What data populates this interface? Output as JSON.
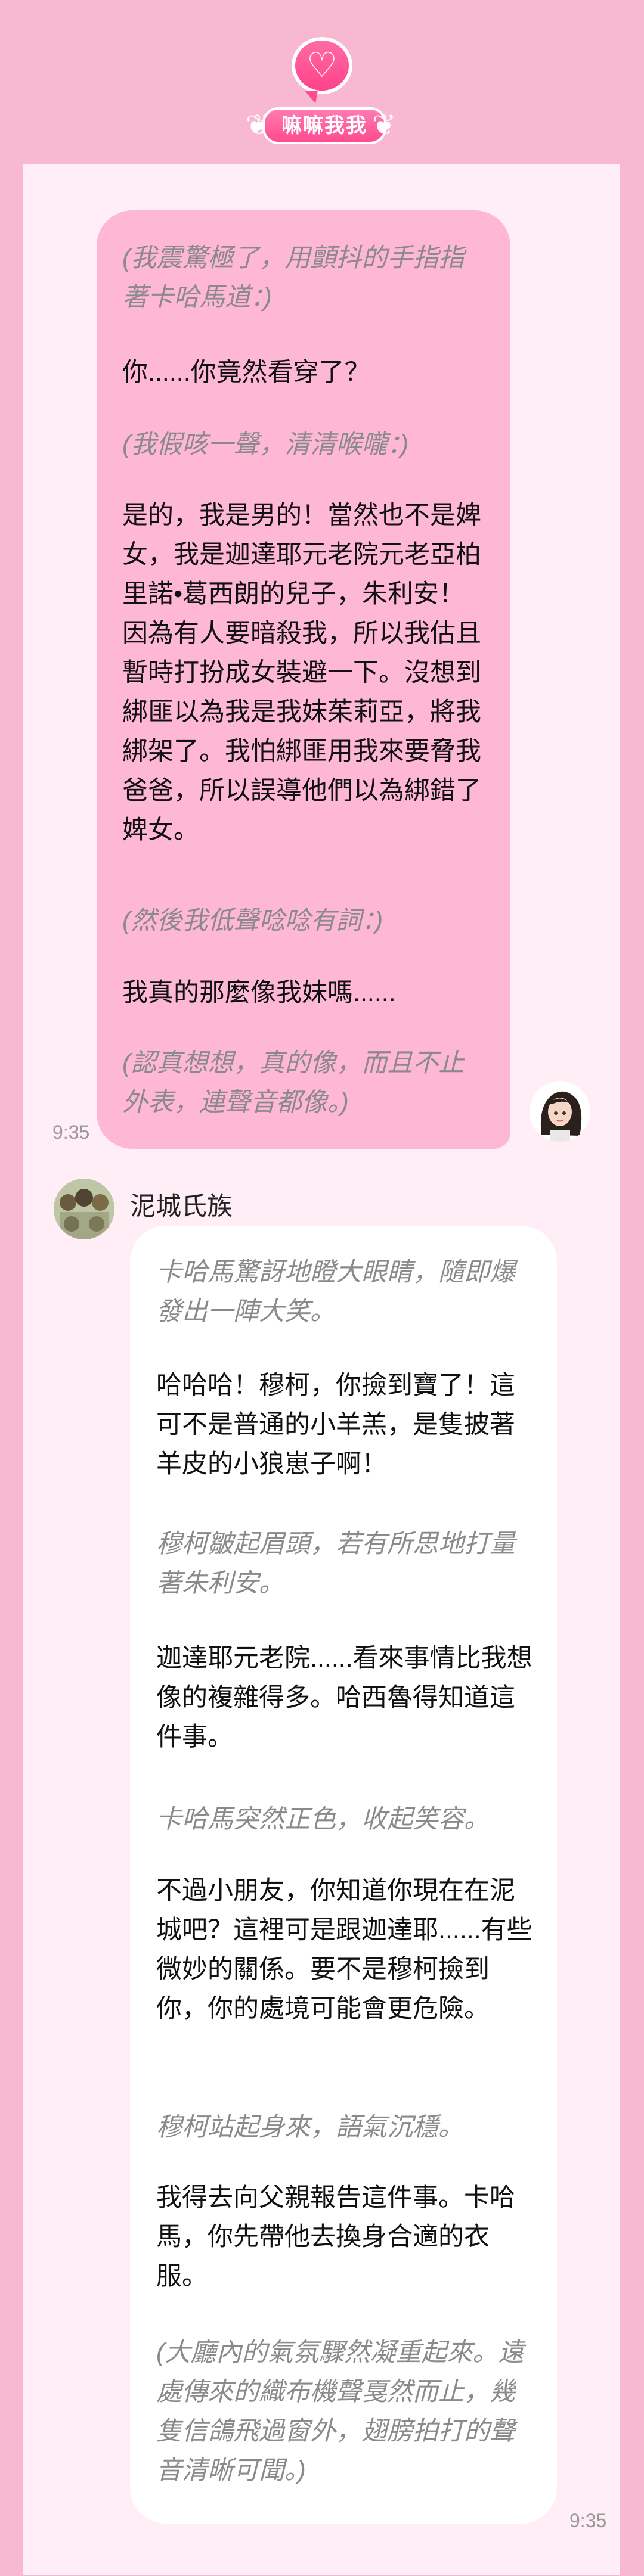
{
  "header": {
    "logo_title": "嘛嘛我我"
  },
  "self": {
    "timestamp": "9:35",
    "messages": [
      "(我震驚極了，用顫抖的手指指著卡哈馬道：)",
      "你......你竟然看穿了？",
      "(我假咳一聲，清清喉嚨：)",
      "是的，我是男的！當然也不是婢女，我是迦達耶元老院元老亞柏里諾•葛西朗的兒子，朱利安！因為有人要暗殺我，所以我估且暫時打扮成女裝避一下。沒想到綁匪以為我是我妹茱莉亞，將我綁架了。我怕綁匪用我來要脅我爸爸，所以誤導他們以為綁錯了婢女。",
      "(然後我低聲唸唸有詞：)",
      "我真的那麼像我妹嗎......",
      "(認真想想，真的像，而且不止外表，連聲音都像。)"
    ]
  },
  "other": {
    "sender_name": "泥城氏族",
    "timestamp": "9:35",
    "messages": [
      "卡哈馬驚訝地瞪大眼睛，隨即爆發出一陣大笑。",
      "哈哈哈！穆柯，你撿到寶了！這可不是普通的小羊羔，是隻披著羊皮的小狼崽子啊！",
      "穆柯皺起眉頭，若有所思地打量著朱利安。",
      "迦達耶元老院......看來事情比我想像的複雜得多。哈西魯得知道這件事。",
      "卡哈馬突然正色，收起笑容。",
      "不過小朋友，你知道你現在在泥城吧？這裡可是跟迦達耶......有些微妙的關係。要不是穆柯撿到你，你的處境可能會更危險。",
      "穆柯站起身來，語氣沉穩。",
      "我得去向父親報告這件事。卡哈馬，你先帶他去換身合適的衣服。",
      "(大廳內的氣氛驟然凝重起來。遠處傳來的織布機聲戛然而止，幾隻信鴿飛過窗外，翅膀拍打的聲音清晰可聞。)"
    ]
  }
}
